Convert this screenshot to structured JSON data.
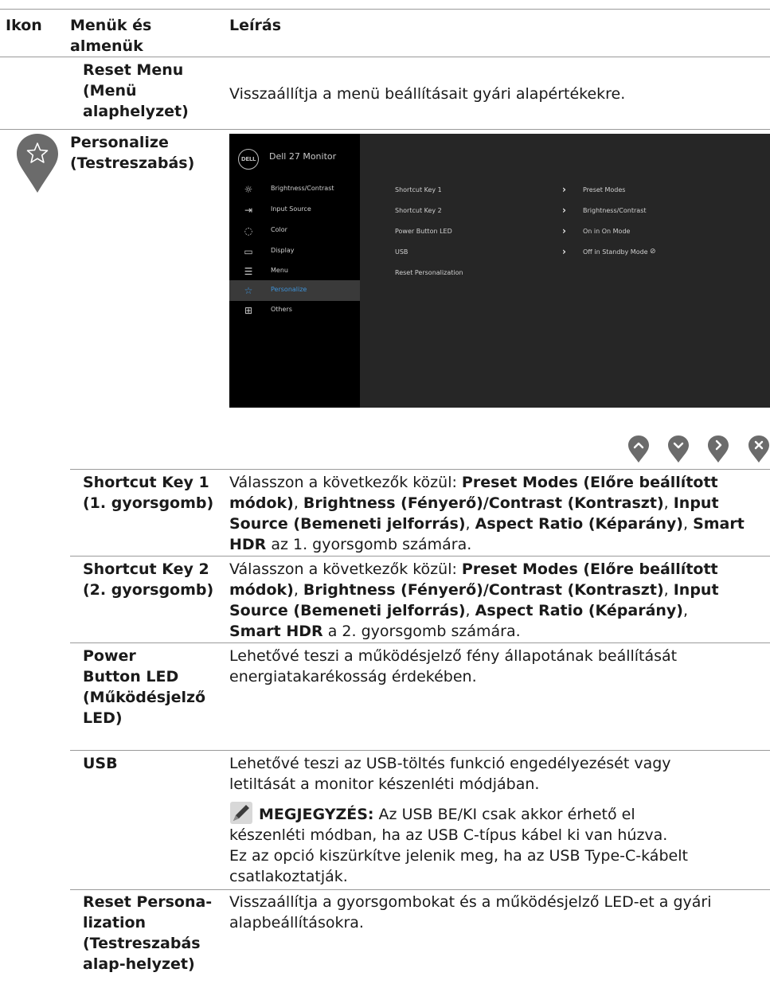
{
  "header": {
    "col1": "Ikon",
    "col2": "Menük és almenük",
    "col3": "Leírás"
  },
  "reset_menu": {
    "name": "Reset Menu (Menü alaphelyzet)",
    "desc": "Visszaállítja a menü beállításait gyári alapértékekre."
  },
  "personalize": {
    "name": "Personalize (Testreszabás)",
    "icon": "star-icon"
  },
  "osd": {
    "title": "Dell 27 Monitor",
    "logo": "DELL",
    "menu": [
      {
        "label": "Brightness/Contrast",
        "icon": "brightness-icon"
      },
      {
        "label": "Input Source",
        "icon": "input-source-icon"
      },
      {
        "label": "Color",
        "icon": "color-icon"
      },
      {
        "label": "Display",
        "icon": "display-icon"
      },
      {
        "label": "Menu",
        "icon": "menu-icon"
      },
      {
        "label": "Personalize",
        "icon": "star-icon",
        "selected": true
      },
      {
        "label": "Others",
        "icon": "others-icon"
      }
    ],
    "options": [
      {
        "label": "Shortcut Key 1",
        "value": "Preset Modes"
      },
      {
        "label": "Shortcut Key 2",
        "value": "Brightness/Contrast"
      },
      {
        "label": "Power Button LED",
        "value": "On in On Mode"
      },
      {
        "label": "USB",
        "value": "Off in Standby Mode"
      },
      {
        "label": "Reset Personalization",
        "value": ""
      }
    ],
    "accent": "#3e93d9"
  },
  "nav_buttons": [
    "up-icon",
    "down-icon",
    "right-icon",
    "close-icon"
  ],
  "rows": {
    "sk1": {
      "name_l1": "Shortcut Key 1",
      "name_l2": "(1. gyorsgomb)"
    },
    "sk2": {
      "name_l1": "Shortcut Key 2",
      "name_l2": "(2. gyorsgomb)"
    },
    "led": {
      "name_l1": "Power",
      "name_l2": "Button LED",
      "name_l3": "(Működésjelző",
      "name_l4": "LED)",
      "desc_l1": "Lehetővé teszi a működésjelző fény állapotának beállítását",
      "desc_l2": "energiatakarékosság érdekében."
    },
    "usb": {
      "name": "USB",
      "desc_l1": "Lehetővé teszi az USB-töltés funkció engedélyezését vagy",
      "desc_l2": "letiltását a monitor készenléti módjában.",
      "note_label": "MEGJEGYZÉS:",
      "note_l1": " Az USB BE/KI csak akkor érhető el",
      "note_l2": "készenléti módban, ha az USB C-típus kábel ki van húzva.",
      "note_l3": "Ez az opció kiszürkítve jelenik meg, ha az USB Type-C-kábelt",
      "note_l4": "csatlakoztatják."
    },
    "resetp": {
      "name_l1": "Reset Persona-",
      "name_l2": "lization",
      "name_l3": "(Testreszabás",
      "name_l4": "alap-helyzet)",
      "desc_l1": "Visszaállítja a gyorsgombokat és a működésjelző LED-et a gyári",
      "desc_l2": "alapbeállításokra."
    }
  },
  "sk_text": {
    "intro": "Válasszon a következők közül: ",
    "preset": "Preset Modes (Előre beállított",
    "modok": "módok)",
    "comma": ", ",
    "bright": "Brightness (Fényerő)/Contrast (Kontraszt)",
    "input1": "Input",
    "input2": "Source (Bemeneti jelforrás)",
    "aspect": "Aspect Ratio (Képarány)",
    "smart": "Smart",
    "hdr": "HDR",
    "tail1": " az 1. gyorsgomb számára.",
    "tail2": " a 2. gyorsgomb számára.",
    "smarthdr": "Smart HDR"
  }
}
